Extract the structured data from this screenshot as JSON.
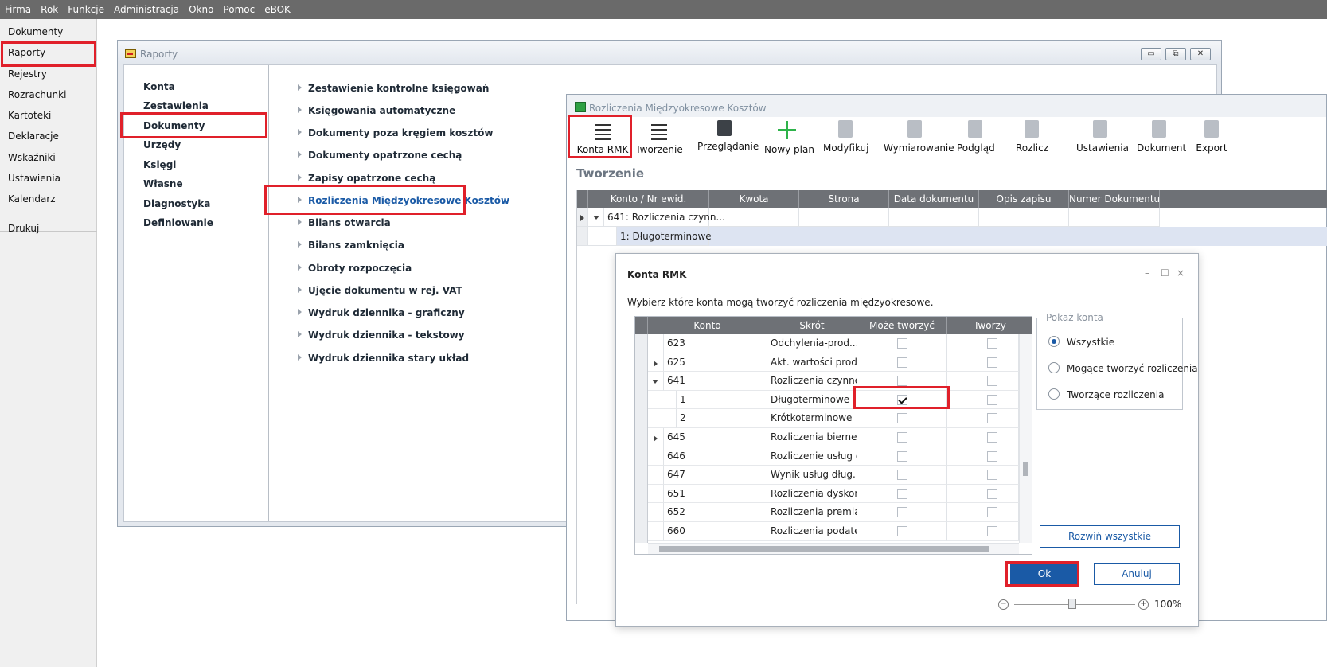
{
  "menubar": {
    "items": [
      "Firma",
      "Rok",
      "Funkcje",
      "Administracja",
      "Okno",
      "Pomoc",
      "eBOK"
    ]
  },
  "leftnav": {
    "items": [
      "Dokumenty",
      "Raporty",
      "Rejestry",
      "Rozrachunki",
      "Kartoteki",
      "Deklaracje",
      "Wskaźniki",
      "Ustawienia",
      "Kalendarz"
    ],
    "extra": "Drukuj",
    "selected": "Raporty"
  },
  "raporty": {
    "title": "Raporty",
    "categories": [
      "Konta",
      "Zestawienia",
      "Dokumenty",
      "Urzędy",
      "Księgi",
      "Własne",
      "Diagnostyka",
      "Definiowanie"
    ],
    "selected_category": "Dokumenty",
    "reports": [
      "Zestawienie kontrolne księgowań",
      "Księgowania automatyczne",
      "Dokumenty poza kręgiem kosztów",
      "Dokumenty opatrzone cechą",
      "Zapisy opatrzone cechą",
      "Rozliczenia Międzyokresowe Kosztów",
      "Bilans otwarcia",
      "Bilans zamknięcia",
      "Obroty rozpoczęcia",
      "Ujęcie dokumentu w rej. VAT",
      "Wydruk dziennika - graficzny",
      "Wydruk dziennika - tekstowy",
      "Wydruk dziennika stary układ"
    ],
    "active_report": "Rozliczenia Międzyokresowe Kosztów"
  },
  "rmk": {
    "title": "Rozliczenia Międzyokresowe Kosztów",
    "toolbar": [
      "Konta RMK",
      "Tworzenie",
      "Przeglądanie",
      "Nowy plan",
      "Modyfikuj",
      "Wymiarowanie",
      "Podgląd",
      "Rozlicz",
      "Ustawienia",
      "Dokument",
      "Export"
    ],
    "heading": "Tworzenie",
    "columns": [
      "Konto / Nr ewid.",
      "Kwota",
      "Strona",
      "Data dokumentu",
      "Opis zapisu",
      "Numer Dokumentu"
    ],
    "rows": [
      {
        "konto": "641: Rozliczenia czynn..."
      },
      {
        "konto": "1: Długoterminowe"
      }
    ]
  },
  "dialog": {
    "title": "Konta RMK",
    "controls": {
      "minimize": "–",
      "maximize": "☐",
      "close": "×"
    },
    "description": "Wybierz które konta mogą tworzyć rozliczenia międzyokresowe.",
    "columns": [
      "Konto",
      "Skrót",
      "Może tworzyć",
      "Tworzy"
    ],
    "rows": [
      {
        "konto": "623",
        "skrot": "Odchylenia-prod....",
        "moze": false,
        "tworzy": false,
        "level": 0,
        "expander": ""
      },
      {
        "konto": "625",
        "skrot": "Akt. wartości prod...",
        "moze": false,
        "tworzy": false,
        "level": 0,
        "expander": "closed"
      },
      {
        "konto": "641",
        "skrot": "Rozliczenia czynne...",
        "moze": false,
        "tworzy": false,
        "level": 0,
        "expander": "open"
      },
      {
        "konto": "1",
        "skrot": "Długoterminowe",
        "moze": true,
        "tworzy": false,
        "level": 1,
        "expander": ""
      },
      {
        "konto": "2",
        "skrot": "Krótkoterminowe",
        "moze": false,
        "tworzy": false,
        "level": 1,
        "expander": ""
      },
      {
        "konto": "645",
        "skrot": "Rozliczenia bierne...",
        "moze": false,
        "tworzy": false,
        "level": 0,
        "expander": "closed"
      },
      {
        "konto": "646",
        "skrot": "Rozliczenie usług d...",
        "moze": false,
        "tworzy": false,
        "level": 0,
        "expander": ""
      },
      {
        "konto": "647",
        "skrot": "Wynik usług dług.",
        "moze": false,
        "tworzy": false,
        "level": 0,
        "expander": ""
      },
      {
        "konto": "651",
        "skrot": "Rozliczenia dyskonto",
        "moze": false,
        "tworzy": false,
        "level": 0,
        "expander": ""
      },
      {
        "konto": "652",
        "skrot": "Rozliczenia premia",
        "moze": false,
        "tworzy": false,
        "level": 0,
        "expander": ""
      },
      {
        "konto": "660",
        "skrot": "Rozliczenia podate...",
        "moze": false,
        "tworzy": false,
        "level": 0,
        "expander": ""
      }
    ],
    "group": {
      "title": "Pokaż konta",
      "options": [
        "Wszystkie",
        "Mogące tworzyć rozliczenia",
        "Tworzące rozliczenia"
      ],
      "selected": "Wszystkie"
    },
    "expand_all": "Rozwiń wszystkie",
    "ok": "Ok",
    "cancel": "Anuluj",
    "zoom": "100%"
  },
  "colors": {
    "menubar": "#6a6a6a",
    "highlight": "#e0202a",
    "primary": "#1a5aa6",
    "grid_header": "#6e7176",
    "selected_row": "#dde4f2"
  }
}
